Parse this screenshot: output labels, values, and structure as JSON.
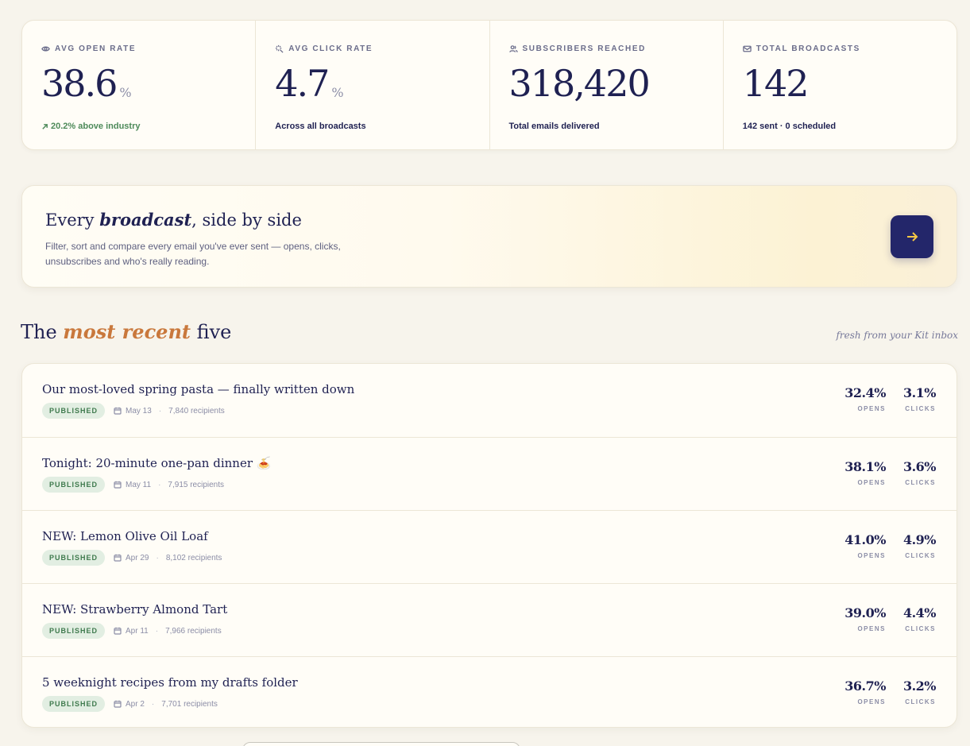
{
  "stats": [
    {
      "icon": "eye-icon",
      "label": "AVG OPEN RATE",
      "value": "38.6",
      "unit": "%",
      "sub": "20.2% above industry",
      "sub_positive": true
    },
    {
      "icon": "sparkle-icon",
      "label": "AVG CLICK RATE",
      "value": "4.7",
      "unit": "%",
      "sub": "Across all broadcasts",
      "sub_positive": false
    },
    {
      "icon": "users-icon",
      "label": "SUBSCRIBERS REACHED",
      "value": "318,420",
      "unit": "",
      "sub": "Total emails delivered",
      "sub_positive": false
    },
    {
      "icon": "mail-icon",
      "label": "TOTAL BROADCASTS",
      "value": "142",
      "unit": "",
      "sub": "142 sent · 0 scheduled",
      "sub_positive": false
    }
  ],
  "promo": {
    "title_pre": "Every ",
    "title_em": "broadcast",
    "title_post": ", side by side",
    "description": "Filter, sort and compare every email you've ever sent — opens, clicks, unsubscribes and who's really reading."
  },
  "section": {
    "title_pre": "The ",
    "title_em": "most recent",
    "title_post": " five",
    "aside": "fresh from your Kit inbox"
  },
  "metric_labels": {
    "opens": "OPENS",
    "clicks": "CLICKS"
  },
  "broadcasts": [
    {
      "title": "Our most-loved spring pasta — finally written down",
      "status": "PUBLISHED",
      "date": "May 13",
      "recipients": "7,840 recipients",
      "opens": "32.4%",
      "clicks": "3.1%"
    },
    {
      "title": "Tonight: 20-minute one-pan dinner 🍝",
      "status": "PUBLISHED",
      "date": "May 11",
      "recipients": "7,915 recipients",
      "opens": "38.1%",
      "clicks": "3.6%"
    },
    {
      "title": "NEW: Lemon Olive Oil Loaf",
      "status": "PUBLISHED",
      "date": "Apr 29",
      "recipients": "8,102 recipients",
      "opens": "41.0%",
      "clicks": "4.9%"
    },
    {
      "title": "NEW: Strawberry Almond Tart",
      "status": "PUBLISHED",
      "date": "Apr 11",
      "recipients": "7,966 recipients",
      "opens": "39.0%",
      "clicks": "4.4%"
    },
    {
      "title": "5 weeknight recipes from my drafts folder",
      "status": "PUBLISHED",
      "date": "Apr 2",
      "recipients": "7,701 recipients",
      "opens": "36.7%",
      "clicks": "3.2%"
    }
  ],
  "colors": {
    "navy": "#1f2152",
    "accent": "#c9783c",
    "positive": "#4d8a5a",
    "button": "#23266a",
    "arrow": "#f5c744"
  }
}
